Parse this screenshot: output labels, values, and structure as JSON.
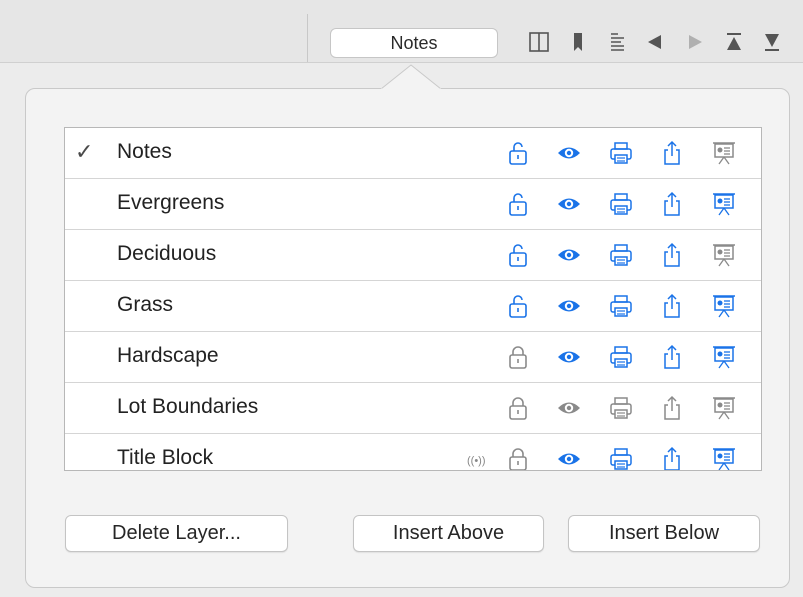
{
  "toolbar": {
    "popup_label": "Notes",
    "icons": [
      "columns-icon",
      "bookmark-icon",
      "text-align-icon",
      "back-icon",
      "forward-icon",
      "move-to-top-icon",
      "move-to-bottom-icon"
    ]
  },
  "layers": [
    {
      "name": "Notes",
      "checked": true,
      "lock": "unlocked",
      "visible": "on",
      "print": "on",
      "export": "on",
      "present": "off",
      "sync": false
    },
    {
      "name": "Evergreens",
      "checked": false,
      "lock": "unlocked",
      "visible": "on",
      "print": "on",
      "export": "on",
      "present": "on",
      "sync": false
    },
    {
      "name": "Deciduous",
      "checked": false,
      "lock": "unlocked",
      "visible": "on",
      "print": "on",
      "export": "on",
      "present": "off",
      "sync": false
    },
    {
      "name": "Grass",
      "checked": false,
      "lock": "unlocked",
      "visible": "on",
      "print": "on",
      "export": "on",
      "present": "on",
      "sync": false
    },
    {
      "name": "Hardscape",
      "checked": false,
      "lock": "locked",
      "visible": "on",
      "print": "on",
      "export": "on",
      "present": "on",
      "sync": false
    },
    {
      "name": "Lot Boundaries",
      "checked": false,
      "lock": "locked",
      "visible": "off",
      "print": "off",
      "export": "off",
      "present": "off",
      "sync": false
    },
    {
      "name": "Title Block",
      "checked": false,
      "lock": "locked",
      "visible": "on",
      "print": "on",
      "export": "on",
      "present": "on",
      "sync": true
    }
  ],
  "checkmark_glyph": "✓",
  "sync_glyph": "((•))",
  "buttons": {
    "delete": "Delete Layer...",
    "insert_above": "Insert Above",
    "insert_below": "Insert Below"
  },
  "colors": {
    "accent": "#1a73e8",
    "inactive": "#8a8a8a"
  }
}
